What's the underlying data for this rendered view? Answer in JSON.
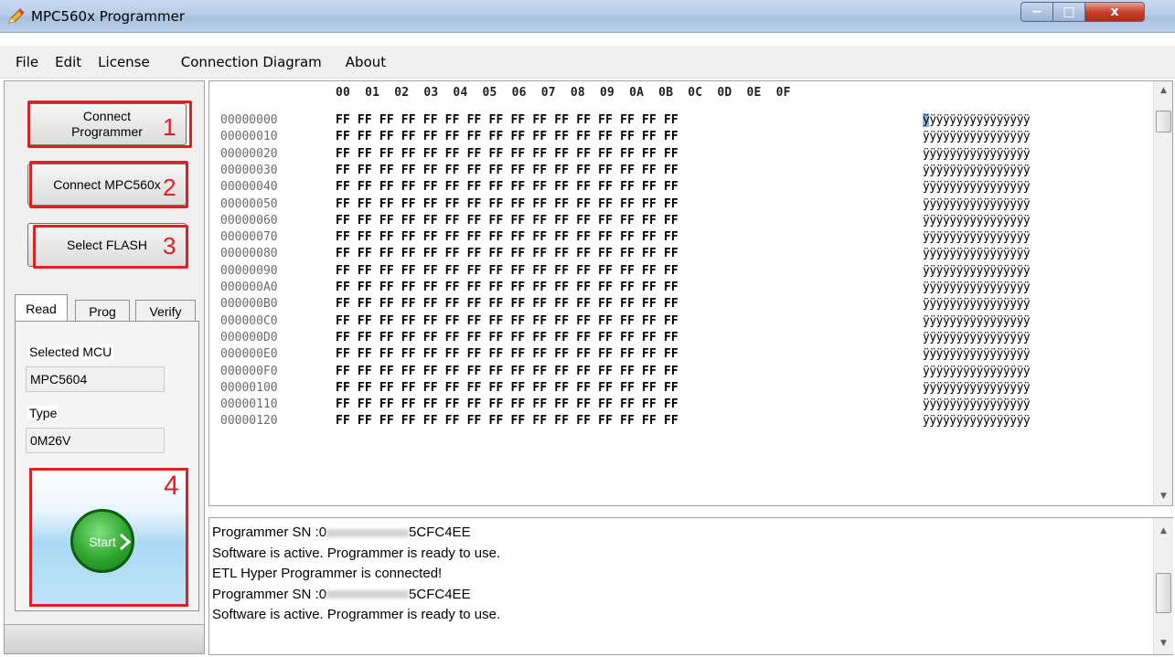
{
  "window": {
    "title": "MPC560x Programmer",
    "app_icon": "pencil-icon",
    "controls": {
      "minimize": "−",
      "maximize": "□",
      "close": "x"
    }
  },
  "menu": [
    "File",
    "Edit",
    "License",
    "Connection Diagram",
    "About"
  ],
  "left_panel": {
    "buttons": [
      {
        "label": "Connect\nProgrammer",
        "marker": "1"
      },
      {
        "label": "Connect MPC560x",
        "marker": "2"
      },
      {
        "label": "Select FLASH",
        "marker": "3"
      }
    ],
    "tabs": [
      "Read",
      "Prog",
      "Verify"
    ],
    "active_tab": "Read",
    "selected_mcu_label": "Selected MCU",
    "selected_mcu_value": "MPC5604",
    "type_label": "Type",
    "type_value": "0M26V",
    "start_label": "Start",
    "start_marker": "4",
    "highlight_color": "#e02020"
  },
  "hex_view": {
    "columns": [
      "00",
      "01",
      "02",
      "03",
      "04",
      "05",
      "06",
      "07",
      "08",
      "09",
      "0A",
      "0B",
      "0C",
      "0D",
      "0E",
      "0F"
    ],
    "rows": [
      {
        "address": "00000000",
        "bytes": "FF FF FF FF FF FF FF FF FF FF FF FF FF FF FF FF",
        "ascii": "ÿÿÿÿÿÿÿÿÿÿÿÿÿÿÿÿ",
        "selected_first_char": true
      },
      {
        "address": "00000010",
        "bytes": "FF FF FF FF FF FF FF FF FF FF FF FF FF FF FF FF",
        "ascii": "ÿÿÿÿÿÿÿÿÿÿÿÿÿÿÿÿ"
      },
      {
        "address": "00000020",
        "bytes": "FF FF FF FF FF FF FF FF FF FF FF FF FF FF FF FF",
        "ascii": "ÿÿÿÿÿÿÿÿÿÿÿÿÿÿÿÿ"
      },
      {
        "address": "00000030",
        "bytes": "FF FF FF FF FF FF FF FF FF FF FF FF FF FF FF FF",
        "ascii": "ÿÿÿÿÿÿÿÿÿÿÿÿÿÿÿÿ"
      },
      {
        "address": "00000040",
        "bytes": "FF FF FF FF FF FF FF FF FF FF FF FF FF FF FF FF",
        "ascii": "ÿÿÿÿÿÿÿÿÿÿÿÿÿÿÿÿ"
      },
      {
        "address": "00000050",
        "bytes": "FF FF FF FF FF FF FF FF FF FF FF FF FF FF FF FF",
        "ascii": "ÿÿÿÿÿÿÿÿÿÿÿÿÿÿÿÿ"
      },
      {
        "address": "00000060",
        "bytes": "FF FF FF FF FF FF FF FF FF FF FF FF FF FF FF FF",
        "ascii": "ÿÿÿÿÿÿÿÿÿÿÿÿÿÿÿÿ"
      },
      {
        "address": "00000070",
        "bytes": "FF FF FF FF FF FF FF FF FF FF FF FF FF FF FF FF",
        "ascii": "ÿÿÿÿÿÿÿÿÿÿÿÿÿÿÿÿ"
      },
      {
        "address": "00000080",
        "bytes": "FF FF FF FF FF FF FF FF FF FF FF FF FF FF FF FF",
        "ascii": "ÿÿÿÿÿÿÿÿÿÿÿÿÿÿÿÿ"
      },
      {
        "address": "00000090",
        "bytes": "FF FF FF FF FF FF FF FF FF FF FF FF FF FF FF FF",
        "ascii": "ÿÿÿÿÿÿÿÿÿÿÿÿÿÿÿÿ"
      },
      {
        "address": "000000A0",
        "bytes": "FF FF FF FF FF FF FF FF FF FF FF FF FF FF FF FF",
        "ascii": "ÿÿÿÿÿÿÿÿÿÿÿÿÿÿÿÿ"
      },
      {
        "address": "000000B0",
        "bytes": "FF FF FF FF FF FF FF FF FF FF FF FF FF FF FF FF",
        "ascii": "ÿÿÿÿÿÿÿÿÿÿÿÿÿÿÿÿ"
      },
      {
        "address": "000000C0",
        "bytes": "FF FF FF FF FF FF FF FF FF FF FF FF FF FF FF FF",
        "ascii": "ÿÿÿÿÿÿÿÿÿÿÿÿÿÿÿÿ"
      },
      {
        "address": "000000D0",
        "bytes": "FF FF FF FF FF FF FF FF FF FF FF FF FF FF FF FF",
        "ascii": "ÿÿÿÿÿÿÿÿÿÿÿÿÿÿÿÿ"
      },
      {
        "address": "000000E0",
        "bytes": "FF FF FF FF FF FF FF FF FF FF FF FF FF FF FF FF",
        "ascii": "ÿÿÿÿÿÿÿÿÿÿÿÿÿÿÿÿ"
      },
      {
        "address": "000000F0",
        "bytes": "FF FF FF FF FF FF FF FF FF FF FF FF FF FF FF FF",
        "ascii": "ÿÿÿÿÿÿÿÿÿÿÿÿÿÿÿÿ"
      },
      {
        "address": "00000100",
        "bytes": "FF FF FF FF FF FF FF FF FF FF FF FF FF FF FF FF",
        "ascii": "ÿÿÿÿÿÿÿÿÿÿÿÿÿÿÿÿ"
      },
      {
        "address": "00000110",
        "bytes": "FF FF FF FF FF FF FF FF FF FF FF FF FF FF FF FF",
        "ascii": "ÿÿÿÿÿÿÿÿÿÿÿÿÿÿÿÿ"
      },
      {
        "address": "00000120",
        "bytes": "FF FF FF FF FF FF FF FF FF FF FF FF FF FF FF FF",
        "ascii": "ÿÿÿÿÿÿÿÿÿÿÿÿÿÿÿÿ"
      }
    ],
    "scrollbar": {
      "up": "▲",
      "down": "▼"
    }
  },
  "log": {
    "lines": [
      {
        "prefix": "Programmer SN :0",
        "suffix": "5CFC4EE",
        "redacted": true
      },
      {
        "text": "Software is active. Programmer is ready to use."
      },
      {
        "text": "ETL Hyper Programmer is connected!"
      },
      {
        "prefix": "Programmer SN :0",
        "suffix": "5CFC4EE",
        "redacted": true
      },
      {
        "text": "Software is active. Programmer is ready to use."
      }
    ],
    "scrollbar": {
      "up": "▲",
      "down": "▼"
    }
  }
}
